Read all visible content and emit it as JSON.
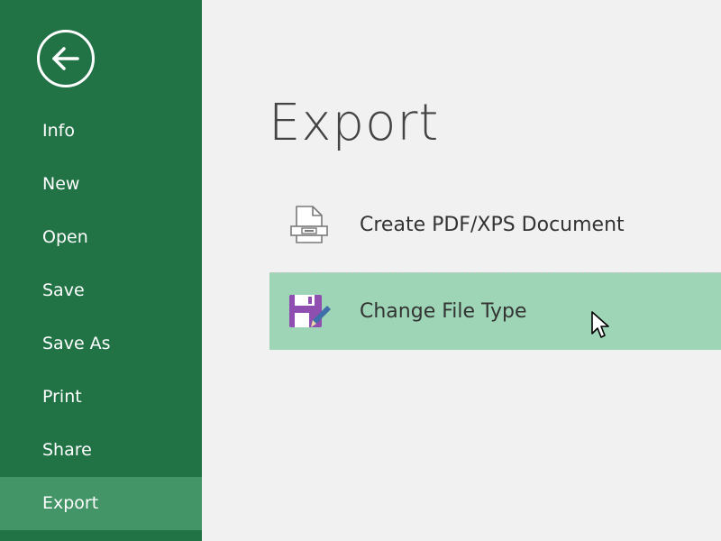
{
  "sidebar": {
    "back_icon": "back-arrow-icon",
    "items": [
      {
        "label": "Info"
      },
      {
        "label": "New"
      },
      {
        "label": "Open"
      },
      {
        "label": "Save"
      },
      {
        "label": "Save As"
      },
      {
        "label": "Print"
      },
      {
        "label": "Share"
      },
      {
        "label": "Export",
        "active": true
      }
    ],
    "background_color": "#217346",
    "active_color": "#439467"
  },
  "main": {
    "title": "Export",
    "options": [
      {
        "label": "Create PDF/XPS Document",
        "icon": "pdf-document-icon"
      },
      {
        "label": "Change File Type",
        "icon": "floppy-disk-pencil-icon",
        "highlighted": true
      }
    ],
    "highlight_color": "#9fd5b7"
  }
}
